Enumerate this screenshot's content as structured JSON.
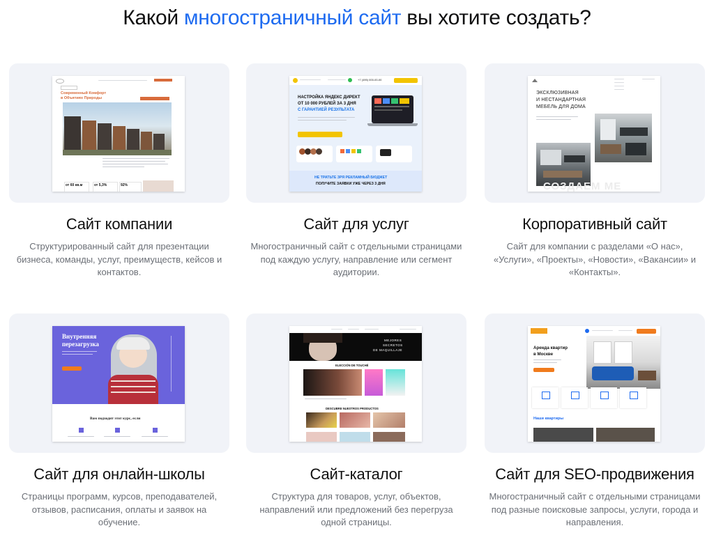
{
  "heading": {
    "before": "Какой ",
    "accent": "многостраничный сайт",
    "after": " вы хотите создать?"
  },
  "colors": {
    "accent": "#1e6bf0",
    "card_bg": "#f1f3f8",
    "description": "#6b6f76"
  },
  "cards": [
    {
      "title": "Сайт компании",
      "description": "Структурированный сайт для презентации бизнеса, команды, услуг, преимуществ, кейсов и контактов.",
      "preview": {
        "hero_line1": "Современный Комфорт",
        "hero_line2": "в Объятиях Природы",
        "stat1": "от 60 кв.м",
        "stat2": "от 5,3%",
        "stat3": "92%"
      }
    },
    {
      "title": "Сайт для услуг",
      "description": "Многостраничный сайт с отдельными страницами под каждую услугу, направление или сегмент аудитории.",
      "preview": {
        "headline1": "НАСТРОЙКА ЯНДЕКС ДИРЕКТ",
        "headline2": "ОТ 10 000 РУБЛЕЙ ЗА 3 ДНЯ",
        "headline3": "С ГАРАНТИЕЙ РЕЗУЛЬТАТА",
        "phone": "+7 (495) 000-00-00",
        "footer1": "НЕ ТРАТЬТЕ ЗРЯ РЕКЛАМНЫЙ БЮДЖЕТ",
        "footer2": "ПОЛУЧИТЕ ЗАЯВКИ УЖЕ ЧЕРЕЗ 3 ДНЯ"
      }
    },
    {
      "title": "Корпоративный сайт",
      "description": "Сайт для компании с разделами «О нас», «Услуги», «Проекты», «Новости», «Вакансии» и «Контакты».",
      "preview": {
        "line1": "ЭКСКЛЮЗИВНАЯ",
        "line2": "И НЕСТАНДАРТНАЯ",
        "line3": "МЕБЕЛЬ ДЛЯ ДОМА",
        "watermark": "СОЗДАЕМ МЕ"
      }
    },
    {
      "title": "Сайт для онлайн-школы",
      "description": "Страницы программ, курсов, преподавателей, отзывов, расписания, оплаты и заявок на обучение.",
      "preview": {
        "hero_line1": "Внутренняя",
        "hero_line2": "перезагрузка",
        "section": "Вам подходит этот курс, если"
      }
    },
    {
      "title": "Сайт-каталог",
      "description": "Структура для товаров, услуг, объектов, направлений или предложений без перегруза одной страницы.",
      "preview": {
        "banner1": "MEJORES",
        "banner2": "SECRETOS",
        "banner3": "DE MAQUILLAJE",
        "section1": "ELECCIÓN DE TOUCHÉ",
        "section2": "DESCUBRE NUESTROS PRODUCTOS"
      }
    },
    {
      "title": "Сайт для SEO-продвижения",
      "description": "Многостраничный сайт с отдельными страницами под разные поисковые запросы, услуги, города и направления.",
      "preview": {
        "hero_line1": "Аренда квартир",
        "hero_line2": "в Москве",
        "section": "Наши квартиры"
      }
    }
  ]
}
